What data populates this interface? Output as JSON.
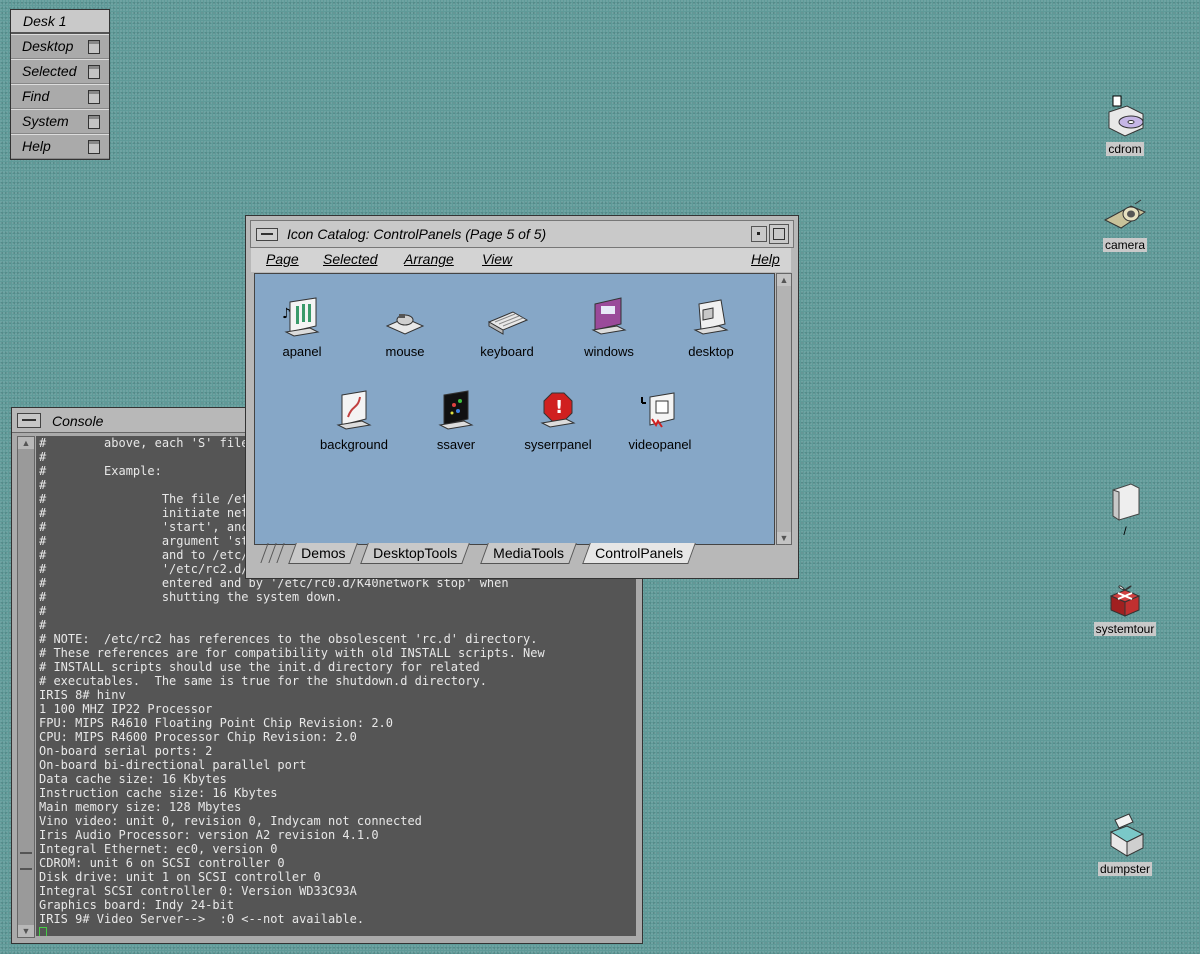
{
  "toolchest": {
    "title": "Desk 1",
    "items": [
      "Desktop",
      "Selected",
      "Find",
      "System",
      "Help"
    ]
  },
  "desktop_icons": {
    "cdrom": "cdrom",
    "camera": "camera",
    "root": "/",
    "systemtour": "systemtour",
    "dumpster": "dumpster"
  },
  "catalog": {
    "title": "Icon Catalog: ControlPanels (Page 5 of 5)",
    "menu": {
      "page": "Page",
      "selected": "Selected",
      "arrange": "Arrange",
      "view": "View",
      "help": "Help"
    },
    "icons": [
      "apanel",
      "mouse",
      "keyboard",
      "windows",
      "desktop",
      "background",
      "ssaver",
      "syserrpanel",
      "videopanel"
    ],
    "tabs": [
      "Demos",
      "DesktopTools",
      "MediaTools",
      "ControlPanels"
    ],
    "active_tab": "ControlPanels"
  },
  "console": {
    "title": "Console",
    "lines": [
      "#        above, each 'S' file",
      "#",
      "#        Example:",
      "#",
      "#                The file /et",
      "#                initiate net",
      "#                'start', anc",
      "#                argument 'st",
      "#                and to /etc/",
      "#                '/etc/rc2.d/",
      "#                entered and by '/etc/rc0.d/K40network stop' when",
      "#                shutting the system down.",
      "#",
      "#",
      "# NOTE:  /etc/rc2 has references to the obsolescent 'rc.d' directory.",
      "# These references are for compatibility with old INSTALL scripts. New",
      "# INSTALL scripts should use the init.d directory for related",
      "# executables.  The same is true for the shutdown.d directory.",
      "IRIS 8# hinv",
      "1 100 MHZ IP22 Processor",
      "FPU: MIPS R4610 Floating Point Chip Revision: 2.0",
      "CPU: MIPS R4600 Processor Chip Revision: 2.0",
      "On-board serial ports: 2",
      "On-board bi-directional parallel port",
      "Data cache size: 16 Kbytes",
      "Instruction cache size: 16 Kbytes",
      "Main memory size: 128 Mbytes",
      "Vino video: unit 0, revision 0, Indycam not connected",
      "Iris Audio Processor: version A2 revision 4.1.0",
      "Integral Ethernet: ec0, version 0",
      "CDROM: unit 6 on SCSI controller 0",
      "Disk drive: unit 1 on SCSI controller 0",
      "Integral SCSI controller 0: Version WD33C93A",
      "Graphics board: Indy 24-bit",
      "IRIS 9# Video Server-->  :0 <--not available."
    ]
  }
}
